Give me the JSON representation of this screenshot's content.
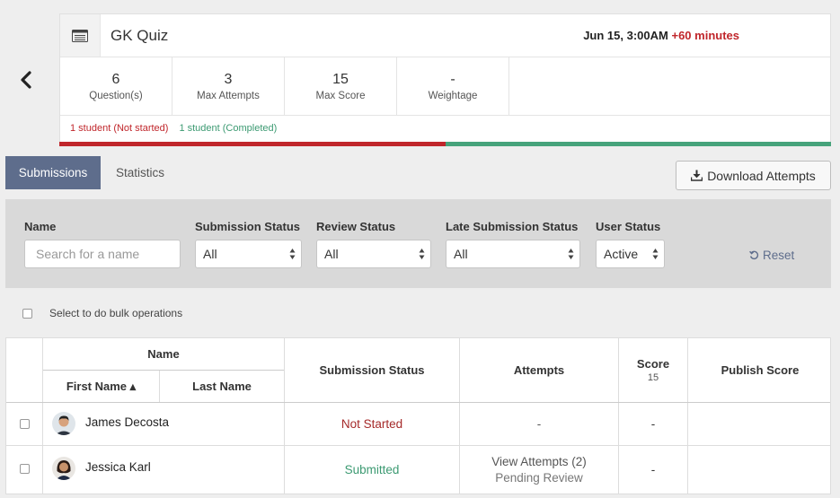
{
  "quiz": {
    "title": "GK Quiz",
    "date": "Jun 15, 3:00AM",
    "extra": "+60 minutes",
    "stats": [
      {
        "value": "6",
        "label": "Question(s)"
      },
      {
        "value": "3",
        "label": "Max Attempts"
      },
      {
        "value": "15",
        "label": "Max Score"
      },
      {
        "value": "-",
        "label": "Weightage"
      }
    ],
    "progress": {
      "not_started": "1 student (Not started)",
      "completed": "1 student (Completed)",
      "not_started_fraction": 0.5,
      "completed_fraction": 0.5
    }
  },
  "tabs": {
    "submissions": "Submissions",
    "statistics": "Statistics"
  },
  "download_label": "Download Attempts",
  "filters": {
    "name_label": "Name",
    "name_placeholder": "Search for a name",
    "submission_status_label": "Submission Status",
    "submission_status_value": "All",
    "review_status_label": "Review Status",
    "review_status_value": "All",
    "late_status_label": "Late Submission Status",
    "late_status_value": "All",
    "user_status_label": "User Status",
    "user_status_value": "Active",
    "reset_label": "Reset"
  },
  "bulk_label": "Select to do bulk operations",
  "table": {
    "headers": {
      "name": "Name",
      "first_name": "First Name ▴",
      "last_name": "Last Name",
      "submission_status": "Submission Status",
      "attempts": "Attempts",
      "score": "Score",
      "score_max": "15",
      "publish_score": "Publish Score"
    },
    "rows": [
      {
        "name": "James Decosta",
        "status": "Not Started",
        "attempts": "-",
        "attempts_sub": "",
        "score": "-"
      },
      {
        "name": "Jessica Karl",
        "status": "Submitted",
        "attempts": "View Attempts (2)",
        "attempts_sub": "Pending Review",
        "score": "-"
      }
    ]
  },
  "colors": {
    "accent": "#5e6d8c",
    "not_started": "#c0262b",
    "completed": "#46a37b"
  }
}
